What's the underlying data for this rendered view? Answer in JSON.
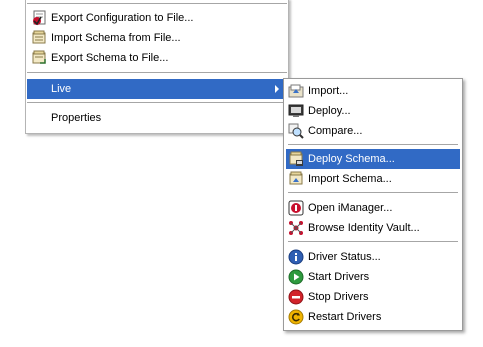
{
  "main_menu": {
    "items": [
      {
        "label": "Export Configuration to File...",
        "icon": "export-config-icon"
      },
      {
        "label": "Import Schema from File...",
        "icon": "import-schema-file-icon"
      },
      {
        "label": "Export Schema to File...",
        "icon": "export-schema-file-icon"
      },
      {
        "label": "Live",
        "icon": ""
      },
      {
        "label": "Properties",
        "icon": ""
      }
    ],
    "highlight_color": "#316ac5"
  },
  "sub_menu": {
    "items": [
      {
        "label": "Import...",
        "icon": "import-icon"
      },
      {
        "label": "Deploy...",
        "icon": "deploy-icon"
      },
      {
        "label": "Compare...",
        "icon": "compare-icon"
      },
      {
        "label": "Deploy Schema...",
        "icon": "deploy-schema-icon"
      },
      {
        "label": "Import Schema...",
        "icon": "import-schema-icon"
      },
      {
        "label": "Open iManager...",
        "icon": "imanager-icon"
      },
      {
        "label": "Browse Identity Vault...",
        "icon": "identity-vault-icon"
      },
      {
        "label": "Driver Status...",
        "icon": "info-icon"
      },
      {
        "label": "Start Drivers",
        "icon": "start-icon"
      },
      {
        "label": "Stop Drivers",
        "icon": "stop-icon"
      },
      {
        "label": "Restart Drivers",
        "icon": "restart-icon"
      }
    ]
  }
}
